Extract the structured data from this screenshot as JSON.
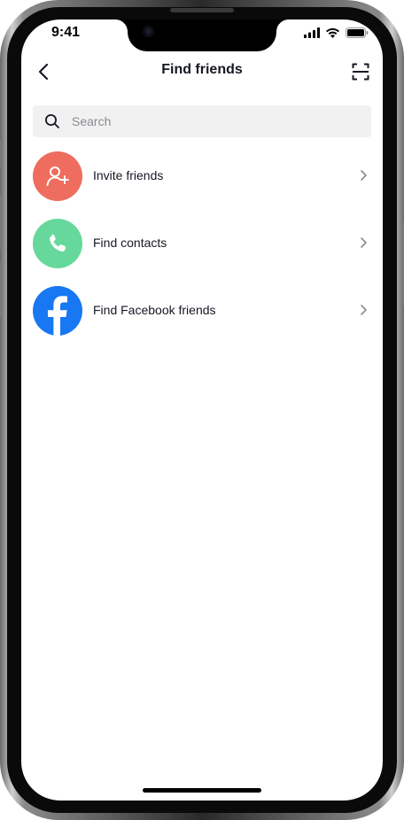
{
  "status_bar": {
    "time": "9:41",
    "icons": [
      "signal-icon",
      "wifi-icon",
      "battery-icon"
    ]
  },
  "header": {
    "title": "Find friends",
    "back_icon": "chevron-left-icon",
    "scan_icon": "scan-icon"
  },
  "search": {
    "placeholder": "Search",
    "value": "",
    "icon": "search-icon"
  },
  "options": [
    {
      "label": "Invite friends",
      "icon": "add-person-icon",
      "color": "#EE6D5F"
    },
    {
      "label": "Find contacts",
      "icon": "phone-icon",
      "color": "#67D89B"
    },
    {
      "label": "Find Facebook friends",
      "icon": "facebook-icon",
      "color": "#1877F2"
    }
  ],
  "colors": {
    "text": "#161823",
    "placeholder": "#8A8B91",
    "search_bg": "#F1F1F2",
    "chevron": "#8A8B91"
  }
}
